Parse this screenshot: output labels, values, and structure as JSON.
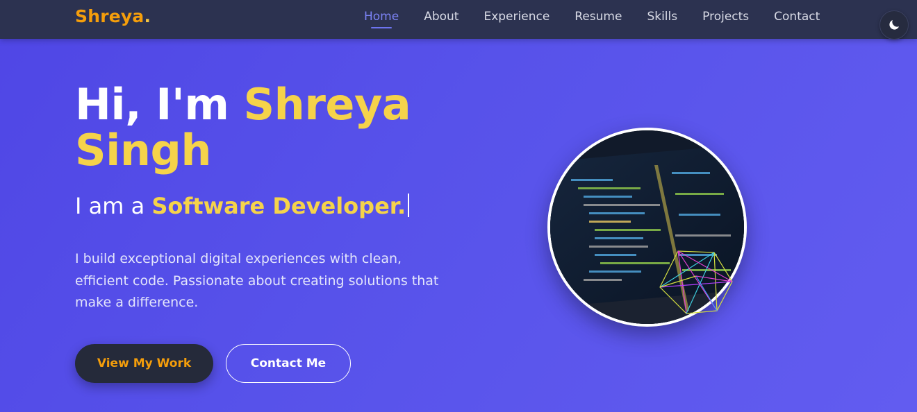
{
  "brand": {
    "name": "Shreya",
    "dot": "."
  },
  "nav": {
    "items": [
      {
        "label": "Home",
        "active": true
      },
      {
        "label": "About",
        "active": false
      },
      {
        "label": "Experience",
        "active": false
      },
      {
        "label": "Resume",
        "active": false
      },
      {
        "label": "Skills",
        "active": false
      },
      {
        "label": "Projects",
        "active": false
      },
      {
        "label": "Contact",
        "active": false
      }
    ],
    "theme_toggle_icon": "moon-icon"
  },
  "hero": {
    "greeting": "Hi, I'm",
    "name": "Shreya Singh",
    "subtitle_prefix": "I am a",
    "role": "Software Developer.",
    "description": "I build exceptional digital experiences with clean, efficient code. Passionate about creating solutions that make a difference.",
    "primary_button": "View My Work",
    "secondary_button": "Contact Me",
    "profile_image": "code-on-laptop-screen-image"
  },
  "colors": {
    "background": "#5752ea",
    "navbar": "#2c3250",
    "brand": "#f59e0b",
    "highlight": "#f5d34a",
    "nav_active": "#7c83f5",
    "button_dark": "#252a3a"
  }
}
